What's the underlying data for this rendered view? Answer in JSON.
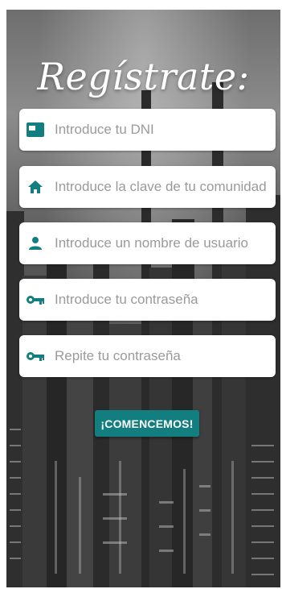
{
  "screen": {
    "title": "Regístrate:"
  },
  "form": {
    "fields": [
      {
        "icon": "id-card-icon",
        "placeholder": "Introduce tu DNI",
        "value": ""
      },
      {
        "icon": "home-icon",
        "placeholder": "Introduce la clave de tu comunidad",
        "value": ""
      },
      {
        "icon": "person-icon",
        "placeholder": "Introduce un nombre de usuario",
        "value": ""
      },
      {
        "icon": "key-icon",
        "placeholder": "Introduce tu contraseña",
        "value": ""
      },
      {
        "icon": "key-icon",
        "placeholder": "Repite tu contraseña",
        "value": ""
      }
    ],
    "submit_label": "¡COMENCEMOS!"
  },
  "colors": {
    "accent": "#127e7f",
    "field_background": "#ffffff",
    "placeholder_text": "#9a9a9a"
  }
}
